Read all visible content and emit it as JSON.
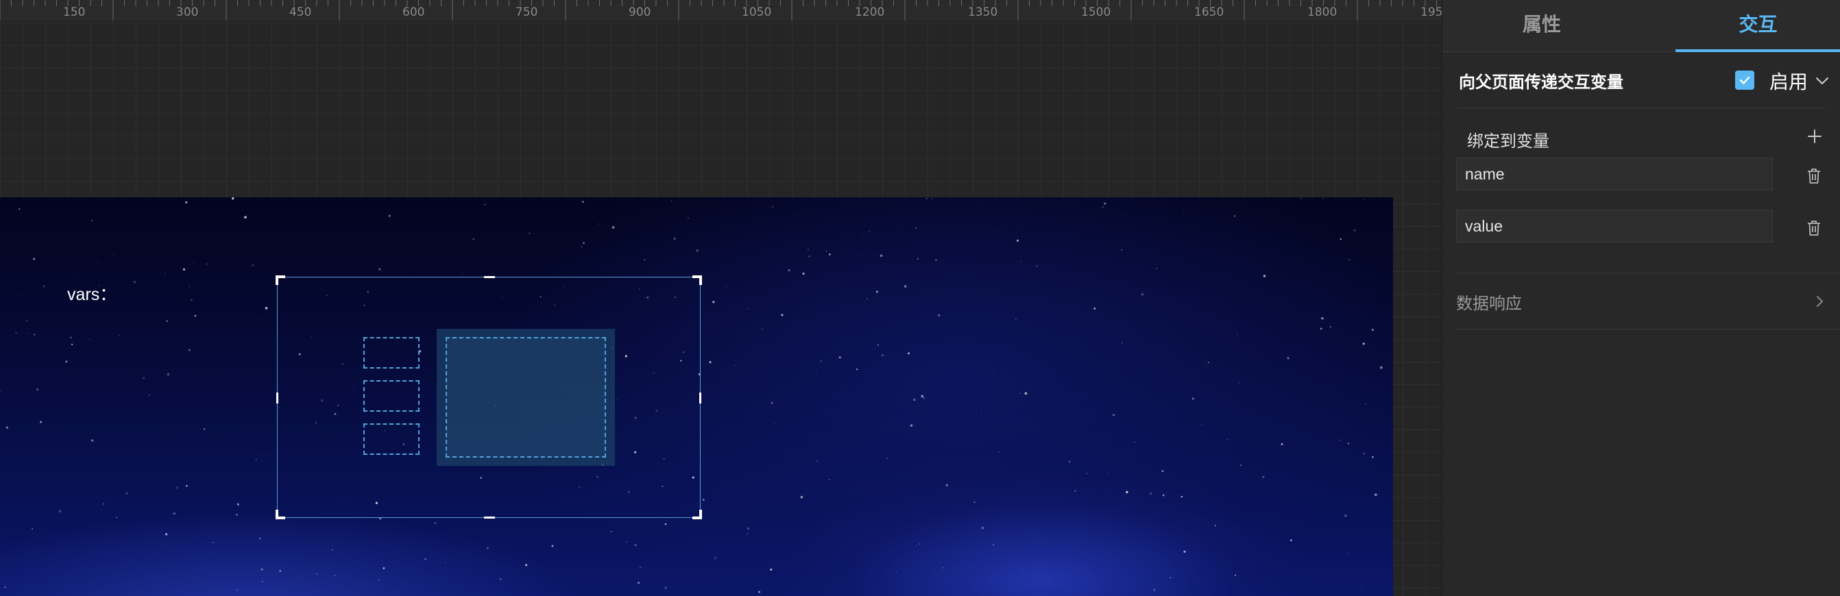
{
  "ruler": {
    "labels": [
      "150",
      "300",
      "450",
      "600",
      "750",
      "900",
      "1050",
      "1200",
      "1350",
      "1500",
      "1650",
      "1800",
      "195"
    ]
  },
  "canvas": {
    "vars_label": "vars："
  },
  "panel": {
    "tabs": [
      {
        "label": "属性",
        "active": false
      },
      {
        "label": "交互",
        "active": true
      }
    ],
    "accent_color": "#5ab8f5",
    "section": {
      "title": "向父页面传递交互变量",
      "enable_label": "启用",
      "enabled": true
    },
    "bind": {
      "label": "绑定到变量",
      "variables": [
        "name",
        "value"
      ]
    },
    "data_response": {
      "label": "数据响应"
    }
  },
  "icons": [
    "checkmark-icon",
    "chevron-down-icon",
    "plus-icon",
    "trash-icon",
    "chevron-right-icon"
  ]
}
